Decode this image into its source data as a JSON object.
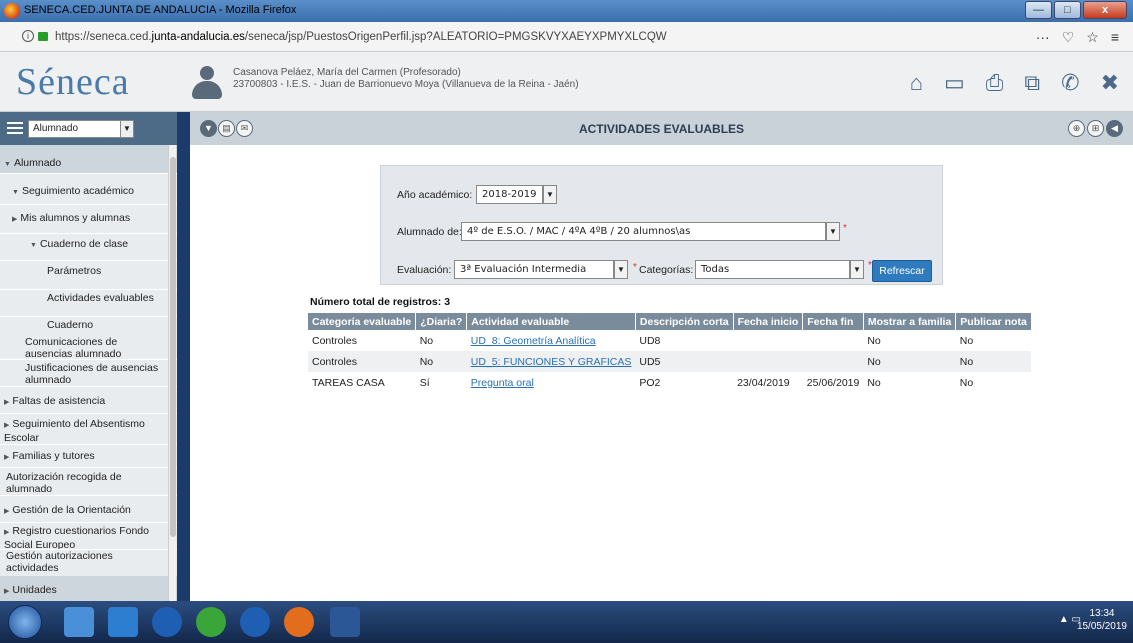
{
  "window": {
    "title": "SENECA.CED.JUNTA DE ANDALUCIA - Mozilla Firefox",
    "min_label": "—",
    "max_label": "□",
    "close_label": "x"
  },
  "browser": {
    "url_prefix": "https://seneca.ced.",
    "url_domain": "junta-andalucia.es",
    "url_rest": "/seneca/jsp/PuestosOrigenPerfil.jsp?ALEATORIO=PMGSKVYXAEYXPMYXLCQW",
    "tools": [
      "···",
      "♡",
      "☆",
      "≡"
    ]
  },
  "header": {
    "logo": "Séneca",
    "user_line1": "Casanova Peláez, María del Carmen (Profesorado)",
    "user_line2": "23700803 - I.E.S. - Juan de Barrionuevo Moya (Villanueva de la Reina - Jaén)"
  },
  "toolbar": {
    "profile_select": "Alumnado",
    "page_title": "ACTIVIDADES EVALUABLES"
  },
  "sidebar": {
    "items": [
      "Alumnado",
      "Seguimiento académico",
      "Mis alumnos y alumnas",
      "Cuaderno de clase",
      "Parámetros",
      "Actividades evaluables",
      "Cuaderno",
      "Comunicaciones de ausencias alumnado",
      "Justificaciones de ausencias alumnado",
      "Faltas de asistencia",
      "Seguimiento del Absentismo Escolar",
      "Familias y tutores",
      "Autorización recogida de alumnado",
      "Gestión de la Orientación",
      "Registro cuestionarios Fondo Social Europeo",
      "Gestión autorizaciones actividades",
      "Unidades"
    ]
  },
  "form": {
    "year_label": "Año académico:",
    "year_value": "2018-2019",
    "students_label": "Alumnado de:",
    "students_value": "4º de E.S.O. / MAC / 4ºA 4ºB / 20 alumnos\\as",
    "eval_label": "Evaluación:",
    "eval_value": "3ª Evaluación Intermedia",
    "cat_label": "Categorías:",
    "cat_value": "Todas",
    "required_mark": "*",
    "refresh_label": "Refrescar"
  },
  "results": {
    "total_label": "Número total de registros: 3",
    "columns": [
      "Categoría evaluable",
      "¿Diaria?",
      "Actividad evaluable",
      "Descripción corta",
      "Fecha inicio",
      "Fecha fin",
      "Mostrar a familia",
      "Publicar nota"
    ],
    "rows": [
      [
        "Controles",
        "No",
        "UD_8: Geometría Analítica",
        "UD8",
        "",
        "",
        "No",
        "No"
      ],
      [
        "Controles",
        "No",
        "UD_5: FUNCIONES Y GRAFICAS",
        "UD5",
        "",
        "",
        "No",
        "No"
      ],
      [
        "TAREAS CASA",
        "Sí",
        "Pregunta oral",
        "PO2",
        "23/04/2019",
        "25/06/2019",
        "No",
        "No"
      ]
    ]
  },
  "taskbar": {
    "time": "13:34",
    "date": "15/05/2019"
  },
  "colors": {
    "toolbar_dark": "#4d6b86",
    "table_header": "#7a8b9c",
    "link": "#2a6fb5",
    "refresh_button": "#2e7bbf"
  }
}
